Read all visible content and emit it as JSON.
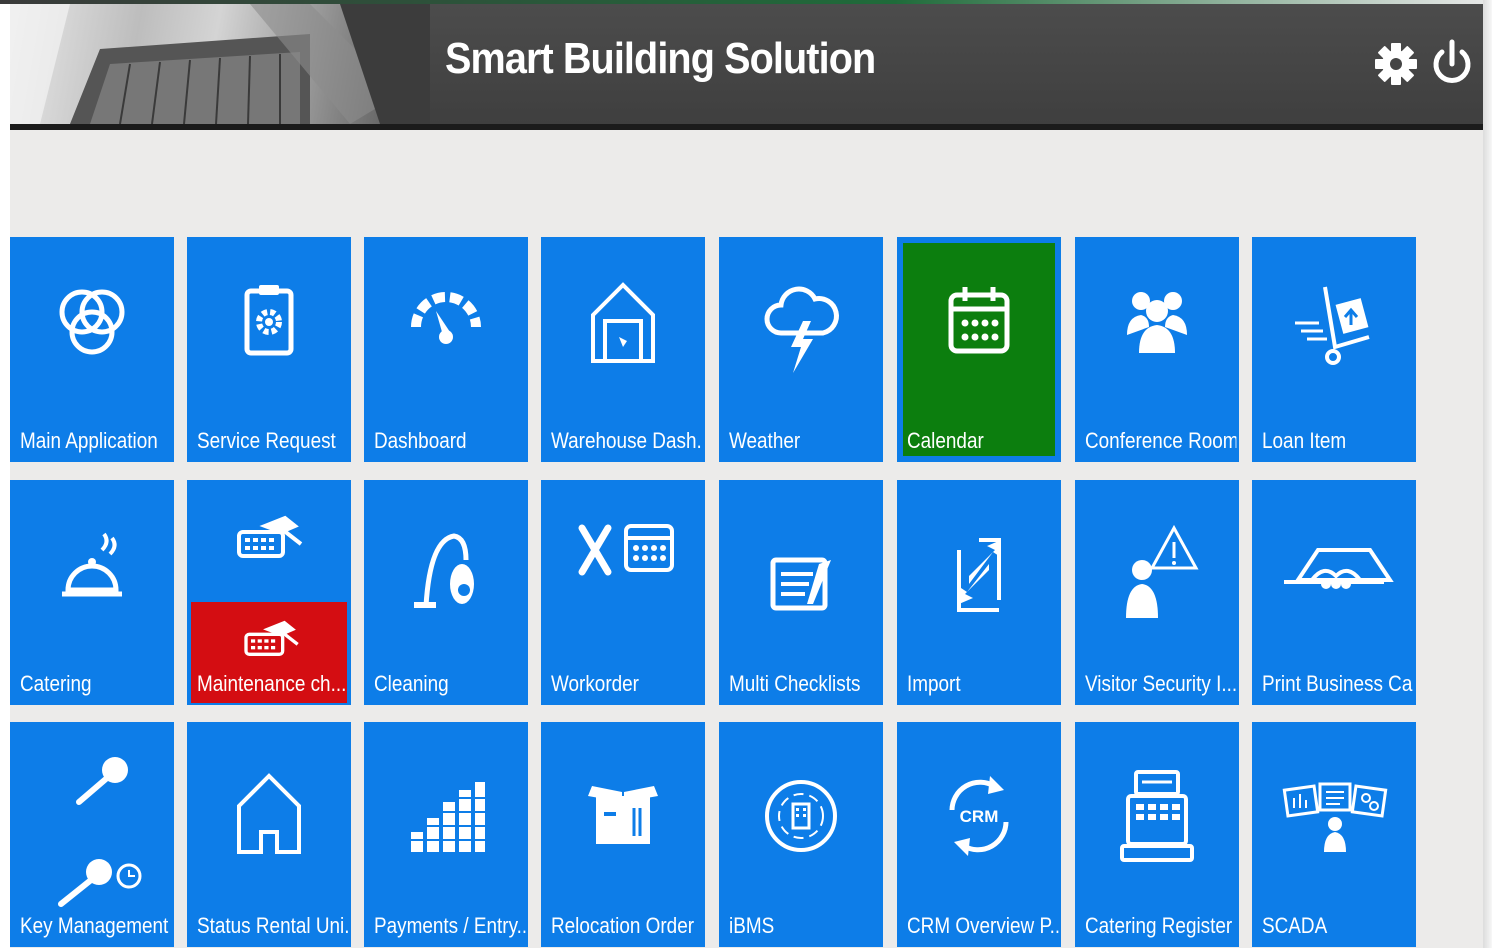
{
  "header": {
    "title": "Smart Building Solution"
  },
  "tiles": [
    {
      "label": "Main Application",
      "icon": "rings-icon"
    },
    {
      "label": "Service Request",
      "icon": "clipboard-gear-icon"
    },
    {
      "label": "Dashboard",
      "icon": "gauge-icon"
    },
    {
      "label": "Warehouse Dash...",
      "icon": "warehouse-icon"
    },
    {
      "label": "Weather",
      "icon": "storm-cloud-icon"
    },
    {
      "label": "Calendar",
      "icon": "calendar-icon"
    },
    {
      "label": "Conference Room",
      "icon": "people-group-icon"
    },
    {
      "label": "Loan Item",
      "icon": "hand-truck-icon"
    },
    {
      "label": "Catering",
      "icon": "cloche-icon"
    },
    {
      "label": "Maintenance ch...",
      "icon": "keyboard-hammer-icon"
    },
    {
      "label": "Cleaning",
      "icon": "vacuum-icon"
    },
    {
      "label": "Workorder",
      "icon": "tools-calendar-icon"
    },
    {
      "label": "Multi Checklists",
      "icon": "checklist-icon"
    },
    {
      "label": "Import",
      "icon": "import-arrows-icon"
    },
    {
      "label": "Visitor Security I...",
      "icon": "visitor-warning-icon"
    },
    {
      "label": "Print Business Ca...",
      "icon": "business-card-hands-icon"
    },
    {
      "label": "Key Management",
      "icon": "keys-icon"
    },
    {
      "label": "Status Rental Uni...",
      "icon": "house-outline-icon"
    },
    {
      "label": "Payments / Entry...",
      "icon": "coin-stacks-icon"
    },
    {
      "label": "Relocation Order",
      "icon": "moving-box-icon"
    },
    {
      "label": "iBMS",
      "icon": "building-circle-icon"
    },
    {
      "label": "CRM Overview P...",
      "icon": "crm-cycle-icon"
    },
    {
      "label": "Catering Register",
      "icon": "cash-register-icon"
    },
    {
      "label": "SCADA",
      "icon": "scada-monitor-icon"
    }
  ],
  "crm_icon_text": "CRM",
  "colors": {
    "tile": "#0d7de8",
    "active_tile": "#0c7e0e",
    "highlight": "#d40d12",
    "header": "#444444"
  }
}
